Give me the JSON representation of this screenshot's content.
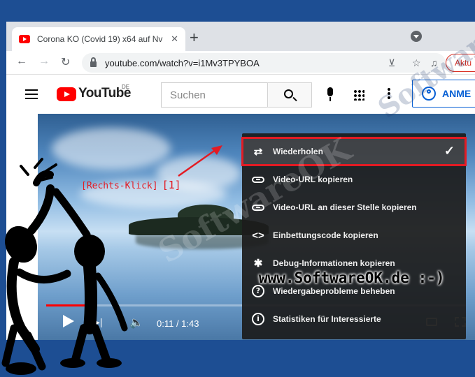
{
  "browser": {
    "tab_title": "Corona KO (Covid 19) x64 auf Nv",
    "tab_close": "✕",
    "new_tab": "+",
    "url": "youtube.com/watch?v=i1Mv3TPYBOA",
    "update_button": "Aktu"
  },
  "youtube": {
    "logo_text": "YouTube",
    "region": "DE",
    "search_placeholder": "Suchen",
    "signin_label": "ANME"
  },
  "player": {
    "time": "0:11 / 1:43",
    "progress": 0.107
  },
  "context_menu": {
    "items": [
      {
        "label": "Wiederholen",
        "icon": "loop-icon",
        "checked": true
      },
      {
        "label": "Video-URL kopieren",
        "icon": "link-icon"
      },
      {
        "label": "Video-URL an dieser Stelle kopieren",
        "icon": "link-icon"
      },
      {
        "label": "Einbettungscode kopieren",
        "icon": "embed-code-icon"
      },
      {
        "label": "Debug-Informationen kopieren",
        "icon": "bug-icon"
      },
      {
        "label": "Wiedergabeprobleme beheben",
        "icon": "help-icon"
      },
      {
        "label": "Statistiken für Interessierte",
        "icon": "info-icon"
      }
    ]
  },
  "annotations": {
    "right_click": "[Rechts-Klick]",
    "step": "[1]",
    "watermark_url": "www.SoftwareOK.de :-)"
  },
  "colors": {
    "accent_red": "#e31b23",
    "youtube_red": "#ff0000",
    "signin_blue": "#065fd4",
    "frame_blue": "#1d4e93"
  }
}
